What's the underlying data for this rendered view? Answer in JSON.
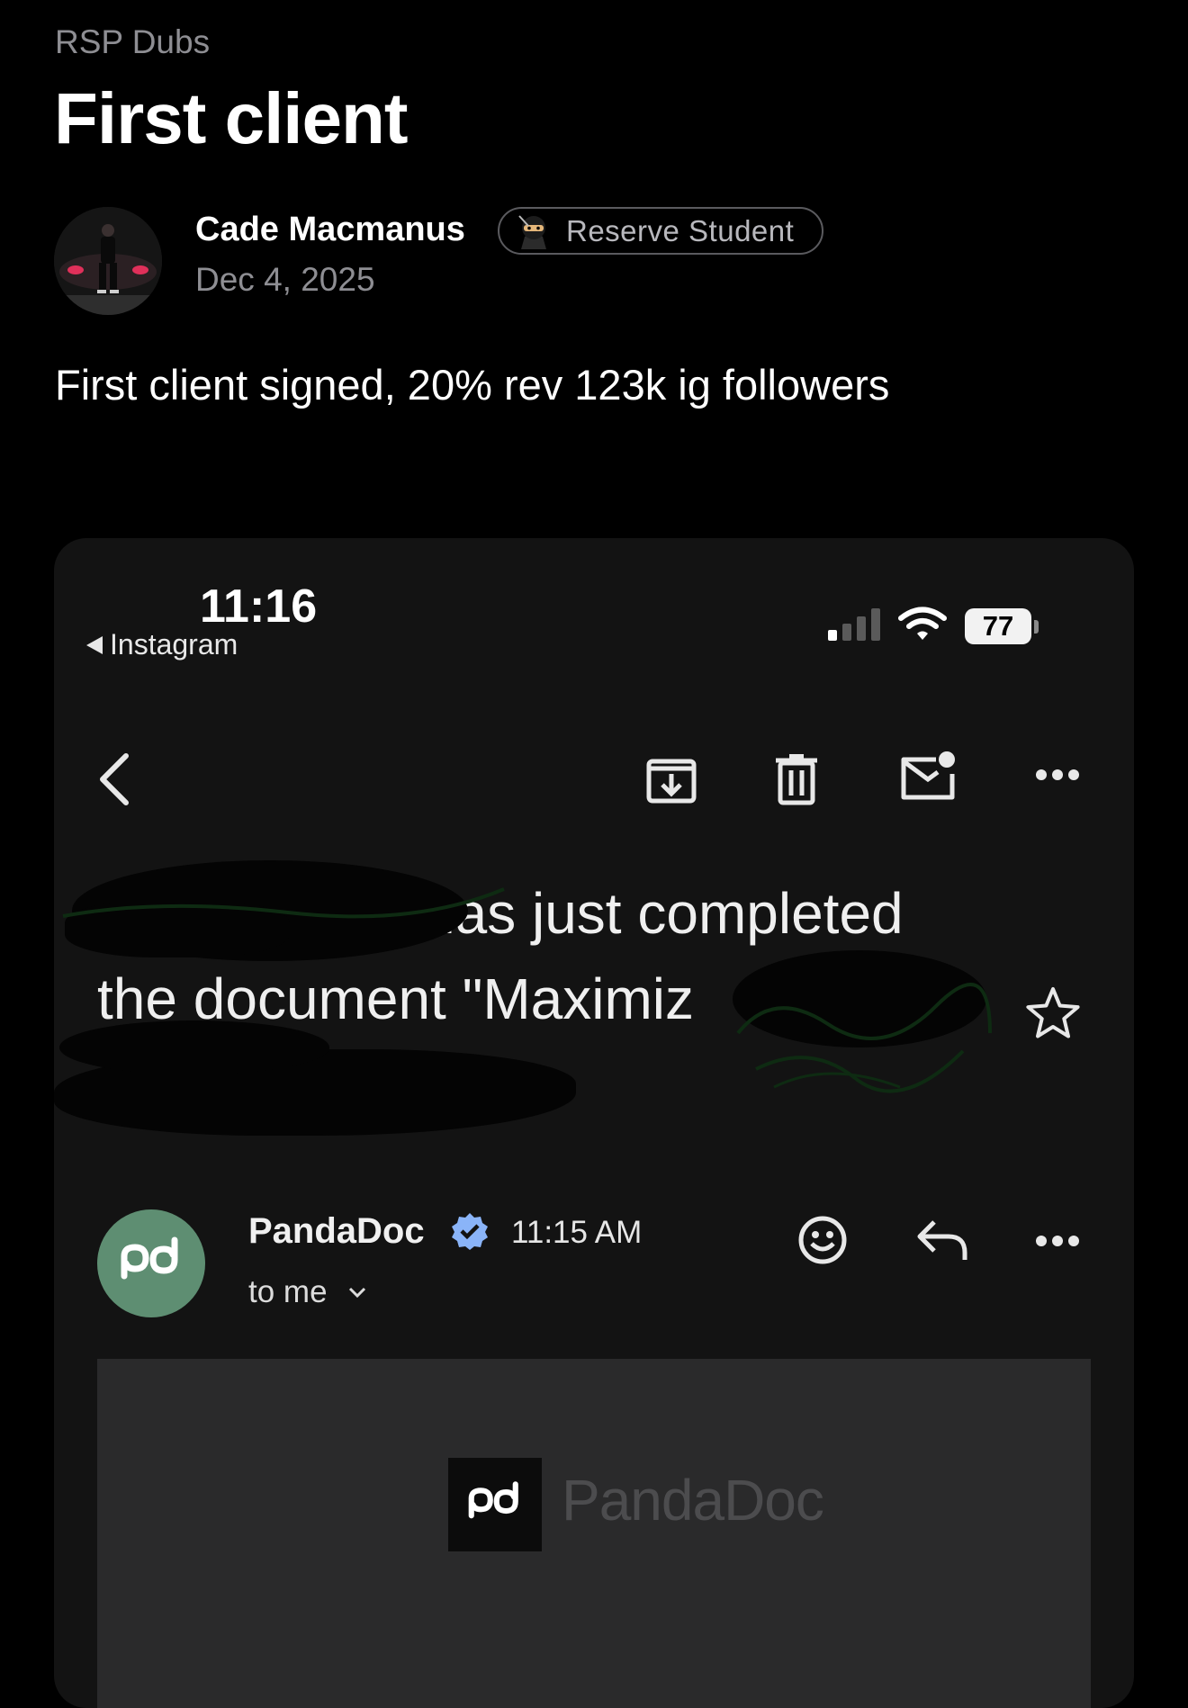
{
  "post": {
    "community": "RSP Dubs",
    "title": "First client",
    "author": "Cade Macmanus",
    "badge": {
      "icon": "ninja-emoji-icon",
      "label": "Reserve Student"
    },
    "date": "Dec 4, 2025",
    "body": "First client signed, 20% rev 123k ig followers"
  },
  "screenshot": {
    "status_bar": {
      "time": "11:16",
      "back_app": "Instagram",
      "battery": "77"
    },
    "toolbar_icons": [
      "back-icon",
      "archive-icon",
      "trash-icon",
      "mark-unread-icon",
      "more-icon"
    ],
    "subject": {
      "line1": "nas just completed",
      "line2": "the document \"Maximiz"
    },
    "message": {
      "sender": "PandaDoc",
      "time": "11:15 AM",
      "recipient": "to me"
    },
    "email_body": {
      "logo_text": "PandaDoc"
    }
  },
  "colors": {
    "background": "#000000",
    "muted_text": "#8e8e93",
    "pandadoc_green": "#5e8e72",
    "verified_blue": "#8ab4f8"
  }
}
